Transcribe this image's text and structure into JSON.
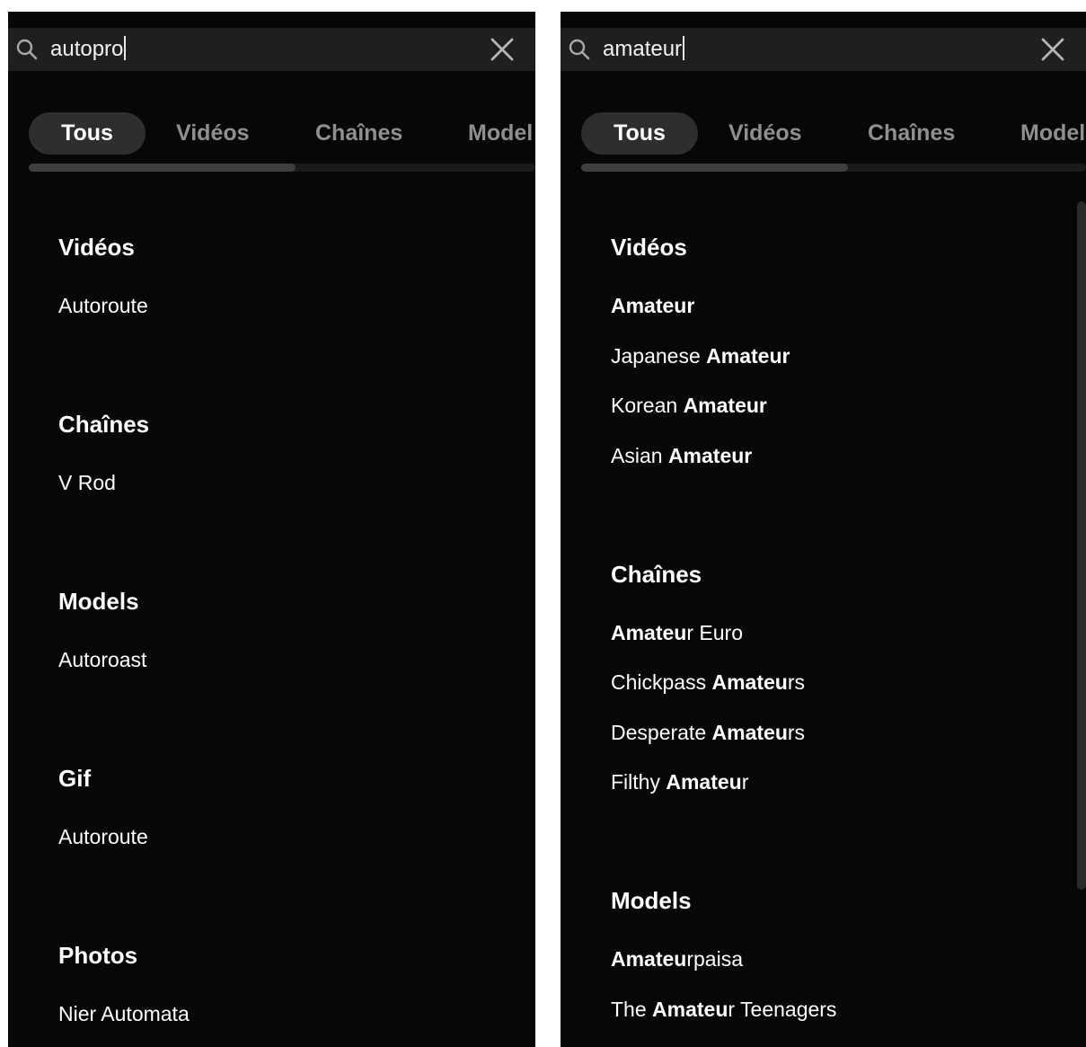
{
  "colors": {
    "panel_bg": "#070707",
    "search_bg": "#1f1f1f",
    "tab_active_bg": "#2e2e2e",
    "tab_inactive_text": "#8f8f8f",
    "text": "#ffffff"
  },
  "left": {
    "search": {
      "value": "autopro",
      "icon": "search-icon",
      "clear_icon": "close-icon"
    },
    "tabs": [
      "Tous",
      "Vidéos",
      "Chaînes",
      "Model"
    ],
    "active_tab": "Tous",
    "sections": [
      {
        "title": "Vidéos",
        "items": [
          [
            {
              "t": "Autoroute",
              "b": false
            }
          ]
        ]
      },
      {
        "title": "Chaînes",
        "items": [
          [
            {
              "t": "V Rod",
              "b": false
            }
          ]
        ]
      },
      {
        "title": "Models",
        "items": [
          [
            {
              "t": "Autoroast",
              "b": false
            }
          ]
        ]
      },
      {
        "title": "Gif",
        "items": [
          [
            {
              "t": "Autoroute",
              "b": false
            }
          ]
        ]
      },
      {
        "title": "Photos",
        "items": [
          [
            {
              "t": "Nier Automata",
              "b": false
            }
          ]
        ]
      }
    ]
  },
  "right": {
    "search": {
      "value": "amateur",
      "icon": "search-icon",
      "clear_icon": "close-icon"
    },
    "tabs": [
      "Tous",
      "Vidéos",
      "Chaînes",
      "Model"
    ],
    "active_tab": "Tous",
    "sections": [
      {
        "title": "Vidéos",
        "items": [
          [
            {
              "t": "Amateur",
              "b": true
            }
          ],
          [
            {
              "t": "Japanese ",
              "b": false
            },
            {
              "t": "Amateur",
              "b": true
            }
          ],
          [
            {
              "t": "Korean ",
              "b": false
            },
            {
              "t": "Amateur",
              "b": true
            }
          ],
          [
            {
              "t": "Asian ",
              "b": false
            },
            {
              "t": "Amateur",
              "b": true
            }
          ]
        ]
      },
      {
        "title": "Chaînes",
        "items": [
          [
            {
              "t": "Amateu",
              "b": true
            },
            {
              "t": "r Euro",
              "b": false
            }
          ],
          [
            {
              "t": "Chickpass ",
              "b": false
            },
            {
              "t": "Amateu",
              "b": true
            },
            {
              "t": "rs",
              "b": false
            }
          ],
          [
            {
              "t": "Desperate ",
              "b": false
            },
            {
              "t": "Amateu",
              "b": true
            },
            {
              "t": "rs",
              "b": false
            }
          ],
          [
            {
              "t": "Filthy ",
              "b": false
            },
            {
              "t": "Amateu",
              "b": true
            },
            {
              "t": "r",
              "b": false
            }
          ]
        ]
      },
      {
        "title": "Models",
        "items": [
          [
            {
              "t": "Amateu",
              "b": true
            },
            {
              "t": "rpaisa",
              "b": false
            }
          ],
          [
            {
              "t": "The ",
              "b": false
            },
            {
              "t": "Amateu",
              "b": true
            },
            {
              "t": "r Teenagers",
              "b": false
            }
          ]
        ]
      }
    ]
  }
}
